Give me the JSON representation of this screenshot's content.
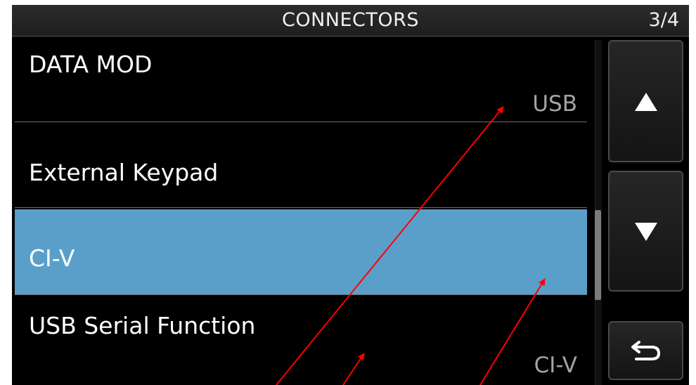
{
  "header": {
    "title": "CONNECTORS",
    "page": "3/4"
  },
  "menu": {
    "items": [
      {
        "label": "DATA MOD",
        "value": "USB",
        "selected": false
      },
      {
        "label": "External Keypad",
        "value": "",
        "selected": false
      },
      {
        "label": "CI-V",
        "value": "",
        "selected": true
      },
      {
        "label": "USB Serial Function",
        "value": "CI-V",
        "selected": false
      }
    ]
  },
  "buttons": {
    "up_icon": "up-triangle-icon",
    "down_icon": "down-triangle-icon",
    "back_icon": "return-arrow-icon"
  },
  "colors": {
    "screen_background": "#000000",
    "selected_row": "#5a9fca",
    "value_text": "#a4a4a4",
    "annotation_arrow": "#ff0000"
  },
  "scrollbar": {
    "page": 3,
    "page_count": 4
  }
}
